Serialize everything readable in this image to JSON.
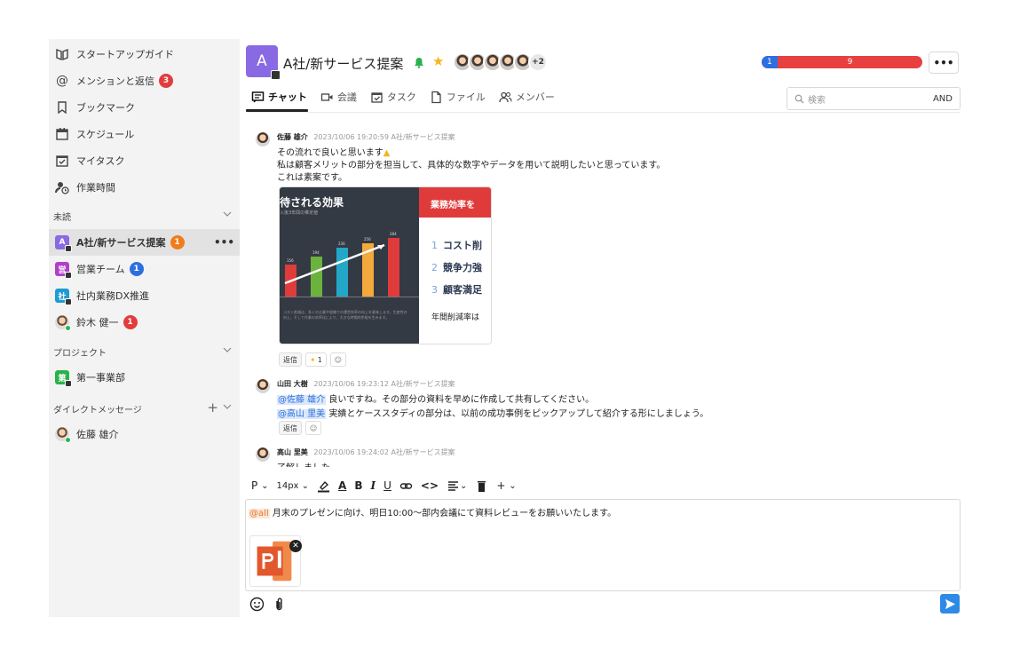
{
  "sidebar": {
    "nav": [
      {
        "label": "スタートアップガイド",
        "icon": "guide-icon"
      },
      {
        "label": "メンションと返信",
        "icon": "mention-icon",
        "badge": "3"
      },
      {
        "label": "ブックマーク",
        "icon": "bookmark-icon"
      },
      {
        "label": "スケジュール",
        "icon": "calendar-icon"
      },
      {
        "label": "マイタスク",
        "icon": "task-icon"
      },
      {
        "label": "作業時間",
        "icon": "work-time-icon"
      }
    ],
    "unread_header": "未読",
    "unread": [
      {
        "label": "A社/新サービス提案",
        "avatar_text": "A",
        "color": "#8a6ae2",
        "badge": "1",
        "badge_color": "orange",
        "more": "•••"
      },
      {
        "label": "営業チーム",
        "avatar_text": "営",
        "color": "#b040c8",
        "badge": "1",
        "badge_color": "blue"
      },
      {
        "label": "社内業務DX推進",
        "avatar_text": "社",
        "color": "#1f9bd1"
      },
      {
        "label": "鈴木 健一",
        "badge": "1",
        "badge_color": "red"
      }
    ],
    "project_header": "プロジェクト",
    "projects": [
      {
        "label": "第一事業部",
        "avatar_text": "第",
        "color": "#2ab24a"
      }
    ],
    "dm_header": "ダイレクトメッセージ",
    "dm_add": "+",
    "dms": [
      {
        "label": "佐藤 雄介"
      }
    ]
  },
  "header": {
    "avatar_text": "A",
    "title": "A社/新サービス提案",
    "member_more": "+2",
    "progress": {
      "done": 1,
      "remaining": 9,
      "done_fraction": 0.1
    },
    "more": "•••",
    "accent": "#e84040"
  },
  "tabs": [
    {
      "label": "チャット",
      "icon": "chat-icon",
      "active": true
    },
    {
      "label": "会議",
      "icon": "video-icon"
    },
    {
      "label": "タスク",
      "icon": "task-icon"
    },
    {
      "label": "ファイル",
      "icon": "file-icon"
    },
    {
      "label": "メンバー",
      "icon": "members-icon"
    }
  ],
  "search": {
    "placeholder": "検索",
    "mode": "AND"
  },
  "messages": [
    {
      "author": "佐藤 雄介",
      "time": "2023/10/06 19:20:59",
      "channel": "A社/新サービス提案",
      "lines": [
        "その流れで良いと思います",
        "私は顧客メリットの部分を担当して、具体的な数字やデータを用いて説明したいと思っています。",
        "これは素案です。"
      ],
      "slide": {
        "left_title": "待される効果",
        "left_sub": "入後3年間の推定値",
        "bars": [
          {
            "value": 156,
            "color": "#e03b3b"
          },
          {
            "value": 194,
            "color": "#6cb33e"
          },
          {
            "value": 236,
            "color": "#23a7c8"
          },
          {
            "value": 256,
            "color": "#f3a93b"
          },
          {
            "value": 284,
            "color": "#e03b3b"
          }
        ],
        "footnote": "コスト削減は、多くの企業や組織での運営効率の向上を意味します。生産性の向上、そして作業の効率化により、大きな時間的余裕を生みます。",
        "right_header": "業務効率を",
        "items": [
          {
            "num": "1",
            "text": "コスト削"
          },
          {
            "num": "2",
            "text": "競争力強"
          },
          {
            "num": "3",
            "text": "顧客満足"
          }
        ],
        "note": "年間削減率は"
      },
      "reactions": {
        "reply": "返信",
        "emoji_count": "1"
      }
    },
    {
      "author": "山田 大樹",
      "time": "2023/10/06 19:23:12",
      "channel": "A社/新サービス提案",
      "line1_mention": "@佐藤 雄介",
      "line1_text": " 良いですね。その部分の資料を早めに作成して共有してください。",
      "line2_mention": "@高山 里美",
      "line2_text": " 実績とケーススタディの部分は、以前の成功事例をピックアップして紹介する形にしましょう。",
      "reactions": {
        "reply": "返信"
      }
    },
    {
      "author": "高山 里美",
      "time": "2023/10/06 19:24:02",
      "channel": "A社/新サービス提案",
      "line": "了解しました"
    }
  ],
  "composer": {
    "toolbar": {
      "paragraph": "P",
      "font_size": "14px"
    },
    "mention": "@all",
    "text": " 月末のプレゼンに向け、明日10:00〜部内会議にて資料レビューをお願いいたします。",
    "attachment_icon": "powerpoint-file-icon"
  }
}
